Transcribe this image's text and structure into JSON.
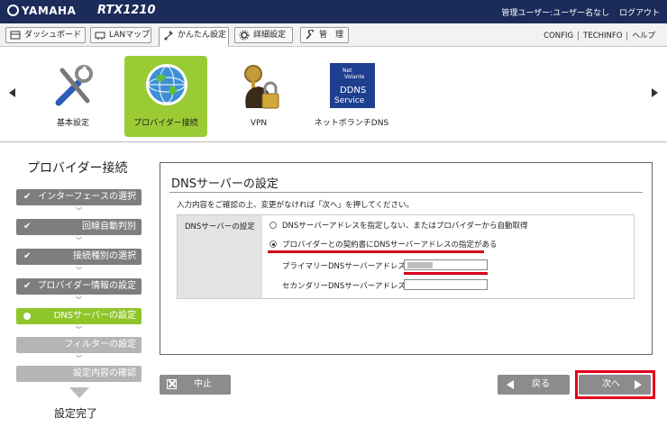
{
  "header": {
    "brand": "YAMAHA",
    "model": "RTX1210",
    "user_label": "管理ユーザー:ユーザー名なし",
    "logout": "ログアウト"
  },
  "nav": {
    "tabs": [
      {
        "label": "ダッシュボード",
        "icon": "dashboard-icon"
      },
      {
        "label": "LANマップ",
        "icon": "lan-map-icon"
      },
      {
        "label": "かんたん設定",
        "icon": "easy-setup-icon"
      },
      {
        "label": "詳細設定",
        "icon": "gear-icon"
      },
      {
        "label": "管　理",
        "icon": "wrench-icon"
      }
    ],
    "links": [
      "CONFIG",
      "TECHINFO",
      "ヘルプ"
    ]
  },
  "categories": [
    {
      "label": "基本設定",
      "icon": "tools-icon"
    },
    {
      "label": "プロバイダー接続",
      "icon": "globe-icon"
    },
    {
      "label": "VPN",
      "icon": "keys-lock-icon"
    },
    {
      "label": "ネットボランチDNS",
      "icon": "ddns-service-icon",
      "icon_text_1": "Net",
      "icon_text_2": "Volante",
      "icon_text_3": "DDNS",
      "icon_text_4": "Service"
    }
  ],
  "wizard": {
    "title": "プロバイダー接続",
    "steps": [
      {
        "label": "インターフェースの選択",
        "state": "done"
      },
      {
        "label": "回線自動判別",
        "state": "done"
      },
      {
        "label": "接続種別の選択",
        "state": "done"
      },
      {
        "label": "プロバイダー情報の設定",
        "state": "done"
      },
      {
        "label": "DNSサーバーの設定",
        "state": "current"
      },
      {
        "label": "フィルターの設定",
        "state": "todo"
      },
      {
        "label": "設定内容の確認",
        "state": "todo"
      }
    ],
    "finish": "設定完了"
  },
  "main": {
    "title": "DNSサーバーの設定",
    "description": "入力内容をご確認の上、変更がなければ「次へ」を押してください。",
    "field_label": "DNSサーバーの設定",
    "option1": "DNSサーバーアドレスを指定しない、またはプロバイダーから自動取得",
    "option2": "プロバイダーとの契約書にDNSサーバーアドレスの指定がある",
    "primary_label": "プライマリーDNSサーバーアドレス",
    "secondary_label": "セカンダリーDNSサーバーアドレス",
    "primary_value": "",
    "secondary_value": ""
  },
  "buttons": {
    "cancel": "中止",
    "back": "戻る",
    "next": "次へ"
  },
  "colors": {
    "header_bg": "#1b2b5a",
    "active_green": "#9acb35",
    "highlight_red": "#d6001c"
  }
}
